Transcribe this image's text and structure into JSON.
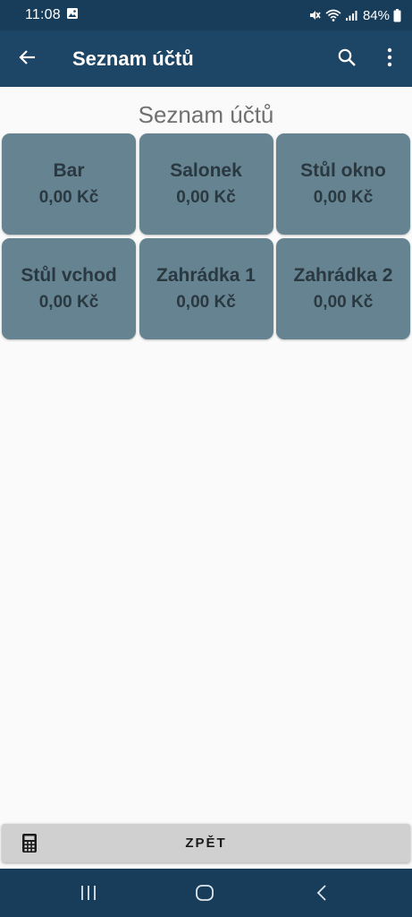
{
  "status_bar": {
    "time": "11:08",
    "battery": "84%",
    "icons": [
      "gallery-icon",
      "mute-icon",
      "wifi-icon",
      "signal-icon",
      "battery-icon"
    ]
  },
  "app_bar": {
    "title": "Seznam účtů",
    "icons": [
      "back-arrow-icon",
      "search-icon",
      "more-vert-icon"
    ]
  },
  "main": {
    "heading": "Seznam účtů",
    "accounts": [
      {
        "name": "Bar",
        "amount": "0,00 Kč"
      },
      {
        "name": "Salonek",
        "amount": "0,00 Kč"
      },
      {
        "name": "Stůl okno",
        "amount": "0,00 Kč"
      },
      {
        "name": "Stůl vchod",
        "amount": "0,00 Kč"
      },
      {
        "name": "Zahrádka 1",
        "amount": "0,00 Kč"
      },
      {
        "name": "Zahrádka 2",
        "amount": "0,00 Kč"
      }
    ]
  },
  "footer": {
    "back_label": "ZPĚT",
    "icon": "calculator-icon"
  },
  "nav_bar": {
    "icons": [
      "recents-icon",
      "home-icon",
      "back-icon"
    ]
  },
  "colors": {
    "status_bar": "#173d5b",
    "app_bar": "#1d4566",
    "tile": "#668391",
    "tile_text": "#2a3840",
    "background": "#fafafa",
    "button": "#d0d0d0"
  }
}
